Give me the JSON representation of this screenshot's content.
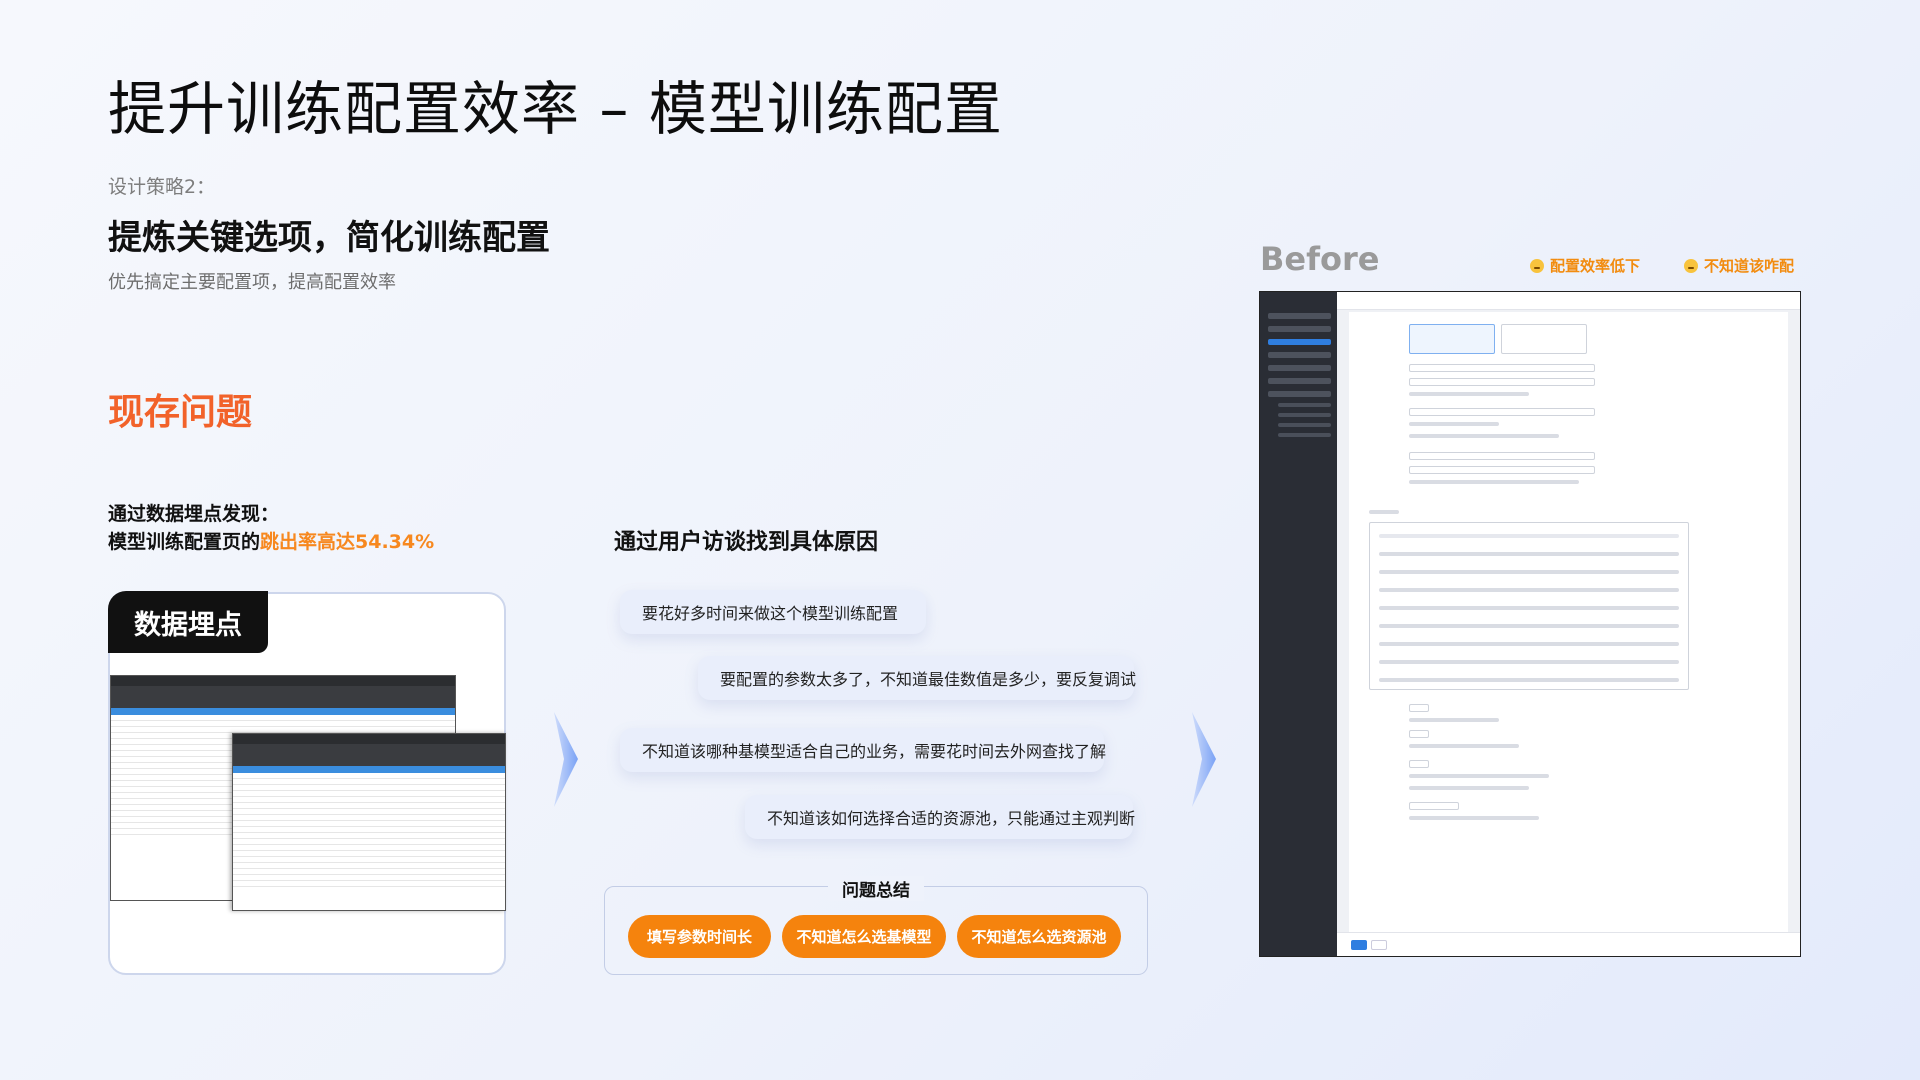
{
  "title": "提升训练配置效率 – 模型训练配置",
  "strategy": {
    "label": "设计策略2：",
    "headline": "提炼关键选项，简化训练配置",
    "subtitle": "优先搞定主要配置项，提高配置效率"
  },
  "problem_section": {
    "title": "现存问题",
    "finding_line1": "通过数据埋点发现：",
    "finding_line2_prefix": "模型训练配置页的",
    "finding_line2_highlight": "跳出率高达54.34%",
    "data_card_tag": "数据埋点"
  },
  "interview": {
    "title": "通过用户访谈找到具体原因",
    "quotes": [
      "要花好多时间来做这个模型训练配置",
      "要配置的参数太多了，不知道最佳数值是多少，要反复调试",
      "不知道该哪种基模型适合自己的业务，需要花时间去外网查找了解",
      "不知道该如何选择合适的资源池，只能通过主观判断"
    ]
  },
  "summary": {
    "title": "问题总结",
    "pills": [
      "填写参数时间长",
      "不知道怎么选基模型",
      "不知道怎么选资源池"
    ]
  },
  "before": {
    "label": "Before",
    "tags": [
      {
        "icon": "sad-face-icon",
        "text": "配置效率低下"
      },
      {
        "icon": "sad-face-icon",
        "text": "不知道该咋配"
      }
    ]
  },
  "colors": {
    "accent_orange": "#f5830d",
    "problem_red": "#f2622a",
    "highlight_orange": "#f7881f"
  }
}
